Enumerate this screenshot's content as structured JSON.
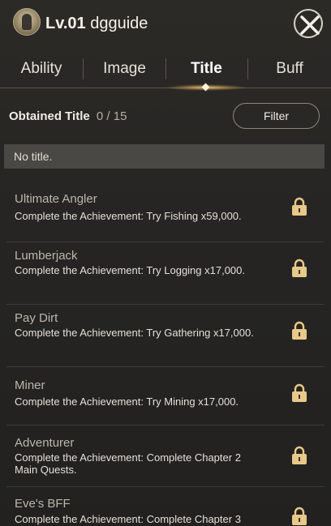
{
  "header": {
    "level": "Lv.01",
    "name": "dgguide"
  },
  "tabs": [
    {
      "label": "Ability",
      "active": false
    },
    {
      "label": "Image",
      "active": false
    },
    {
      "label": "Title",
      "active": true
    },
    {
      "label": "Buff",
      "active": false
    }
  ],
  "obtained": {
    "label": "Obtained Title",
    "count": "0 / 15"
  },
  "filter_label": "Filter",
  "no_title": "No title.",
  "titles": [
    {
      "name": "Ultimate Angler",
      "desc": "Complete the Achievement: Try Fishing x59,000.",
      "locked": true
    },
    {
      "name": "Lumberjack",
      "desc": "Complete the Achievement: Try Logging x17,000.",
      "locked": true
    },
    {
      "name": "Pay Dirt",
      "desc": "Complete the Achievement: Try Gathering x17,000.",
      "locked": true
    },
    {
      "name": "Miner",
      "desc": "Complete the Achievement: Try Mining x17,000.",
      "locked": true
    },
    {
      "name": "Adventurer",
      "desc": "Complete the Achievement: Complete Chapter 2 Main Quests.",
      "locked": true
    },
    {
      "name": "Eve's BFF",
      "desc": "Complete the Achievement: Complete Chapter 3",
      "locked": true
    }
  ],
  "colors": {
    "accent_glow": "#ffbe5a",
    "lock": "#e8c98a"
  }
}
